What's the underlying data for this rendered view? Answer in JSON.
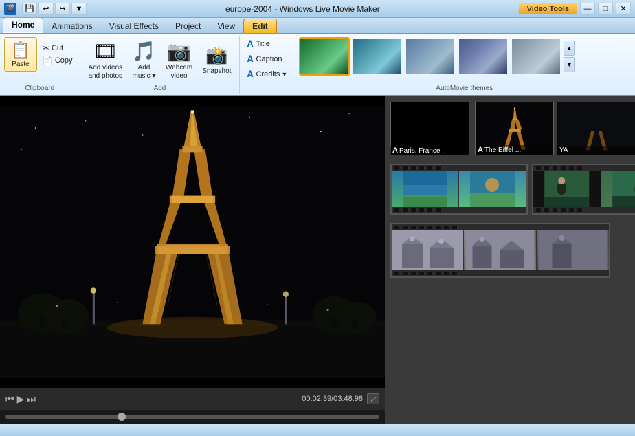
{
  "titleBar": {
    "appName": "europe-2004 - Windows Live Movie Maker",
    "videoToolsLabel": "Video Tools",
    "appIcon": "🎬"
  },
  "quickAccess": {
    "save": "💾",
    "undo": "↩",
    "redo": "↪",
    "dropdown": "▼"
  },
  "ribbonTabs": [
    {
      "id": "home",
      "label": "Home",
      "active": true
    },
    {
      "id": "animations",
      "label": "Animations",
      "active": false
    },
    {
      "id": "visualeffects",
      "label": "Visual Effects",
      "active": false
    },
    {
      "id": "project",
      "label": "Project",
      "active": false
    },
    {
      "id": "view",
      "label": "View",
      "active": false
    },
    {
      "id": "edit",
      "label": "Edit",
      "active": false,
      "highlighted": true
    }
  ],
  "clipboard": {
    "groupLabel": "Clipboard",
    "pasteLabel": "Paste",
    "cutLabel": "Cut",
    "copyLabel": "Copy"
  },
  "addGroup": {
    "groupLabel": "Add",
    "addVideosLabel": "Add videos\nand photos",
    "addMusicLabel": "Add\nmusic",
    "webcamLabel": "Webcam\nvideo",
    "snapshotLabel": "Snapshot"
  },
  "textGroup": {
    "titleLabel": "Title",
    "captionLabel": "Caption",
    "creditsLabel": "Credits"
  },
  "themes": {
    "groupLabel": "AutoMovie themes",
    "items": [
      {
        "id": 1,
        "label": "",
        "selected": true
      },
      {
        "id": 2,
        "label": "",
        "selected": false
      },
      {
        "id": 3,
        "label": "",
        "selected": false
      },
      {
        "id": 4,
        "label": "",
        "selected": false
      },
      {
        "id": 5,
        "label": "",
        "selected": false
      }
    ]
  },
  "preview": {
    "timeDisplay": "00:02.39/03:48.98"
  },
  "storyboard": {
    "clips": [
      {
        "id": 1,
        "label": "A Paris, France :",
        "type": "title",
        "bg": "black"
      },
      {
        "id": 2,
        "label": "A The Eiffel ...",
        "type": "title",
        "bg": "eiffel"
      },
      {
        "id": 3,
        "label": "YA",
        "type": "title",
        "bg": "dark"
      }
    ],
    "filmStrips": [
      {
        "id": 1,
        "bg": "beach"
      },
      {
        "id": 2,
        "bg": "person"
      }
    ],
    "bottomStrip": {
      "id": 3,
      "bg": "building"
    }
  }
}
